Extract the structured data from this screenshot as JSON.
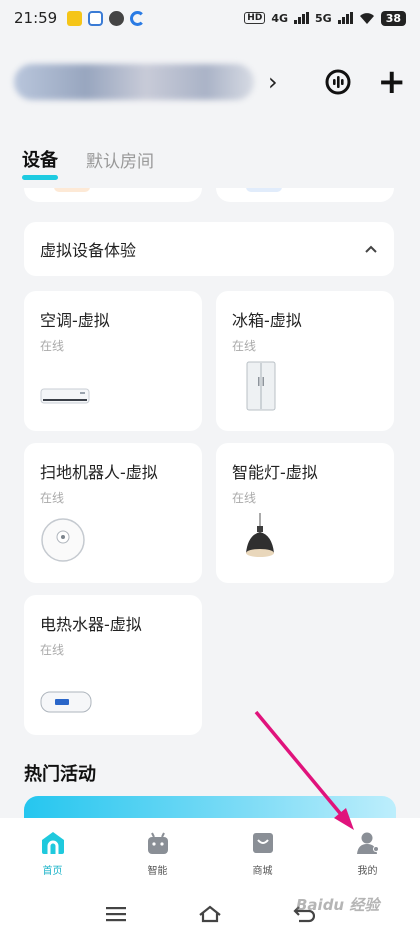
{
  "status_bar": {
    "time": "21:59",
    "network_labels": [
      "4G",
      "5G"
    ],
    "hd_label": "HD",
    "battery": "38"
  },
  "header": {
    "home_name": "",
    "chevron": "›",
    "add_symbol": "+"
  },
  "tabs": [
    {
      "label": "设备",
      "active": true
    },
    {
      "label": "默认房间",
      "active": false
    }
  ],
  "section": {
    "title": "虚拟设备体验",
    "toggle_icon": "chevron-up-icon"
  },
  "devices": [
    {
      "name": "空调-虚拟",
      "status": "在线",
      "icon": "air-conditioner"
    },
    {
      "name": "冰箱-虚拟",
      "status": "在线",
      "icon": "refrigerator"
    },
    {
      "name": "扫地机器人-虚拟",
      "status": "在线",
      "icon": "robot-vacuum"
    },
    {
      "name": "智能灯-虚拟",
      "status": "在线",
      "icon": "pendant-lamp"
    },
    {
      "name": "电热水器-虚拟",
      "status": "在线",
      "icon": "water-heater"
    }
  ],
  "hot_activities": {
    "title": "热门活动"
  },
  "bottom_nav": [
    {
      "label": "首页",
      "icon": "home-icon",
      "active": true
    },
    {
      "label": "智能",
      "icon": "android-icon",
      "active": false
    },
    {
      "label": "商城",
      "icon": "shopping-bag-icon",
      "active": false
    },
    {
      "label": "我的",
      "icon": "user-icon",
      "active": false
    }
  ],
  "watermark": "Baidu 经验",
  "colors": {
    "accent": "#1ecbe1",
    "annotation_arrow": "#e0137c"
  }
}
